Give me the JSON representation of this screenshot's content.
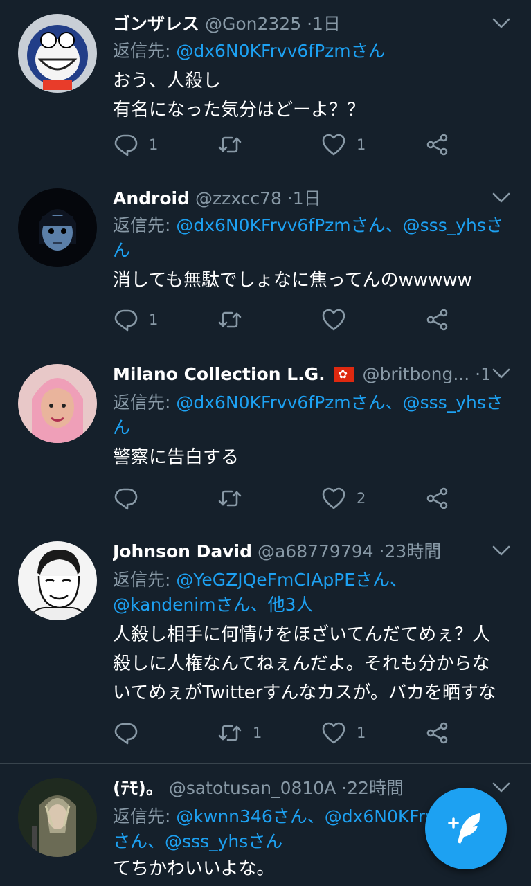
{
  "colors": {
    "background": "#15202b",
    "accent": "#1da1f2",
    "muted": "#8899a6",
    "divider": "#38444d"
  },
  "reply_label": "返信先:",
  "tweets": [
    {
      "name": "ゴンザレス",
      "handle": "@Gon2325",
      "dot": "·",
      "time": "1日",
      "reply_to": [
        "@dx6N0KFrvv6fPzmさん"
      ],
      "text_lines": [
        "おう、人殺し",
        "有名になった気分はどーよ？？"
      ],
      "replies": "1",
      "retweets": "",
      "likes": "1"
    },
    {
      "name": "Android",
      "handle": "@zzxcc78",
      "dot": "·",
      "time": "1日",
      "reply_line1": "@dx6N0KFrvv6fPzmさん、@sss_yhsさ",
      "reply_line2": "ん",
      "text_lines": [
        "消しても無駄でしょなに焦ってんのwwwww"
      ],
      "replies": "1",
      "retweets": "",
      "likes": ""
    },
    {
      "name": "Milano Collection L.G.",
      "handle": "@britbong...",
      "dot": "·",
      "time": "1日",
      "flag_icon": "hong-kong-flag",
      "reply_line1": "@dx6N0KFrvv6fPzmさん、@sss_yhsさ",
      "reply_line2": "ん",
      "text_lines": [
        "警察に告白する"
      ],
      "replies": "",
      "retweets": "",
      "likes": "2"
    },
    {
      "name": "Johnson David",
      "handle": "@a68779794",
      "dot": "·",
      "time": "23時間",
      "reply_line1": "@YeGZJQeFmCIApPEさん、",
      "reply_line2": "@kandenimさん、他3人",
      "text_lines": [
        "人殺し相手に何情けをほざいてんだてめぇ？人",
        "殺しに人権なんてねぇんだよ。それも分からな",
        "いてめぇがTwitterすんなカスが。バカを晒すな"
      ],
      "replies": "",
      "retweets": "1",
      "likes": "1"
    },
    {
      "name": "(ﾃﾓ)。",
      "handle": "@satotusan_0810A",
      "dot": "·",
      "time": "22時間",
      "reply_line1": "@kwnn346さん、@dx6N0KFrv",
      "reply_line2": "さん、@sss_yhsさん",
      "text_lines": [
        "てちかわいいよな。"
      ]
    }
  ],
  "icons": {
    "reply": "reply-icon",
    "retweet": "retweet-icon",
    "like": "heart-icon",
    "share": "share-icon",
    "caret": "chevron-down-icon",
    "compose": "compose-tweet-icon"
  }
}
